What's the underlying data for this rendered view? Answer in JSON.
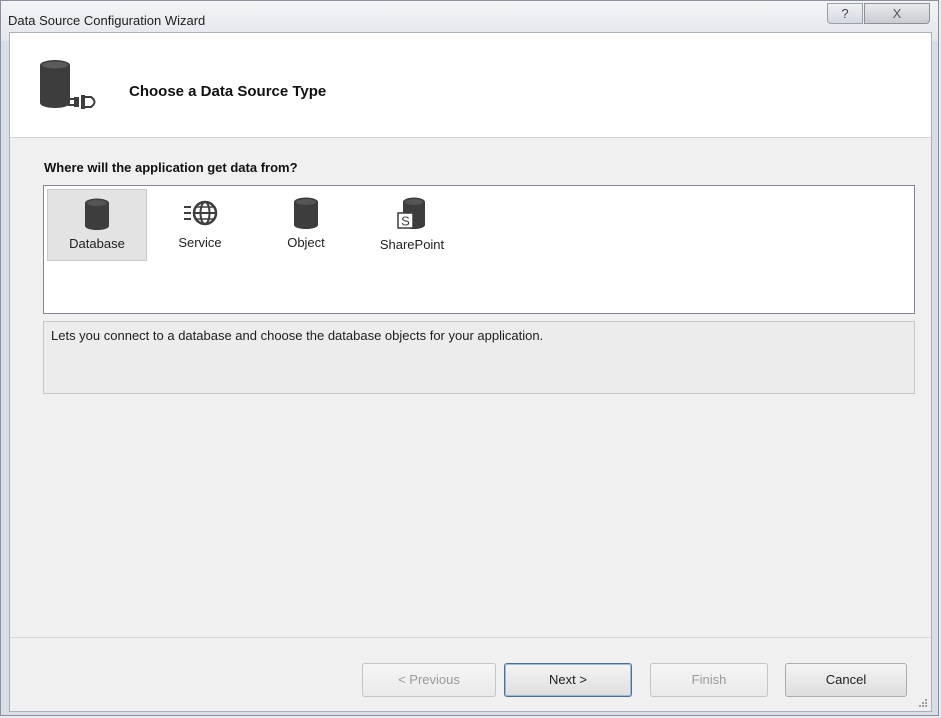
{
  "window": {
    "title": "Data Source Configuration Wizard",
    "help_label": "?",
    "close_label": "X"
  },
  "header": {
    "title": "Choose a Data Source Type",
    "icon": "database-connect-icon"
  },
  "question": "Where will the application get data from?",
  "data_source_types": [
    {
      "label": "Database",
      "icon": "database-icon",
      "selected": true
    },
    {
      "label": "Service",
      "icon": "service-globe-icon",
      "selected": false
    },
    {
      "label": "Object",
      "icon": "object-icon",
      "selected": false
    },
    {
      "label": "SharePoint",
      "icon": "sharepoint-icon",
      "selected": false
    }
  ],
  "description": "Lets you connect to a database and choose the database objects for your application.",
  "buttons": {
    "previous": "< Previous",
    "next": "Next >",
    "finish": "Finish",
    "cancel": "Cancel"
  },
  "colors": {
    "icon_dark": "#3d3d3d",
    "selected_bg": "#e3e3e3",
    "default_button_border": "#4f6f92"
  }
}
